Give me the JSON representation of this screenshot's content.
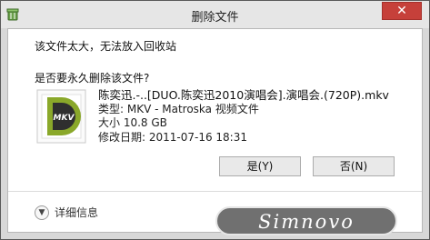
{
  "window": {
    "title": "删除文件",
    "close_glyph": "✕"
  },
  "dialog": {
    "message": "该文件太大，无法放入回收站",
    "question": "是否要永久删除该文件?",
    "file": {
      "icon": "mkv-file-icon",
      "icon_text": "MKV",
      "name": "陈奕迅.-..[DUO.陈奕迅2010演唱会].演唱会.(720P).mkv",
      "type": "类型: MKV - Matroska 视频文件",
      "size": "大小 10.8 GB",
      "modified": "修改日期: 2011-07-16 18:31"
    },
    "yes_label": "是(Y)",
    "no_label": "否(N)",
    "details_label": "详细信息"
  },
  "watermark": {
    "text": "Simnovo"
  },
  "colors": {
    "close_button": "#c6403a",
    "icon_green": "#8aa82a",
    "icon_dark": "#2f2f2f"
  }
}
